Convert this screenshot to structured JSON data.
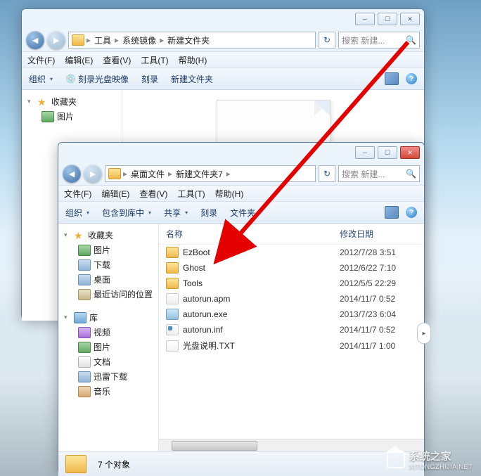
{
  "window1": {
    "breadcrumbs": [
      "工具",
      "系统镜像",
      "新建文件夹"
    ],
    "searchPlaceholder": "搜索 新建...",
    "menus": [
      "文件(F)",
      "编辑(E)",
      "查看(V)",
      "工具(T)",
      "帮助(H)"
    ],
    "toolbar": {
      "organize": "组织",
      "burn": "刻录光盘映像",
      "burn2": "刻录",
      "newfolder": "新建文件夹"
    },
    "sidebar": {
      "fav": "收藏夹",
      "pic": "图片"
    }
  },
  "window2": {
    "breadcrumbs": [
      "桌面文件",
      "新建文件夹7"
    ],
    "searchPlaceholder": "搜索 新建...",
    "menus": [
      "文件(F)",
      "编辑(E)",
      "查看(V)",
      "工具(T)",
      "帮助(H)"
    ],
    "toolbar": {
      "organize": "组织",
      "include": "包含到库中",
      "share": "共享",
      "burn": "刻录",
      "newfolder": "文件夹"
    },
    "sidebar": {
      "fav": "收藏夹",
      "pic": "图片",
      "dl": "下载",
      "desk": "桌面",
      "recent": "最近访问的位置",
      "lib": "库",
      "vid": "视频",
      "pic2": "图片",
      "doc": "文档",
      "xl": "迅雷下载",
      "mus": "音乐"
    },
    "columns": {
      "name": "名称",
      "date": "修改日期"
    },
    "files": [
      {
        "name": "EzBoot",
        "date": "2012/7/28 3:51",
        "kind": "folder"
      },
      {
        "name": "Ghost",
        "date": "2012/6/22 7:10",
        "kind": "folder"
      },
      {
        "name": "Tools",
        "date": "2012/5/5 22:29",
        "kind": "folder"
      },
      {
        "name": "autorun.apm",
        "date": "2014/11/7 0:52",
        "kind": "file"
      },
      {
        "name": "autorun.exe",
        "date": "2013/7/23 6:04",
        "kind": "exe"
      },
      {
        "name": "autorun.inf",
        "date": "2014/11/7 0:52",
        "kind": "inf"
      },
      {
        "name": "光盘说明.TXT",
        "date": "2014/11/7 1:00",
        "kind": "txt"
      }
    ],
    "status": "7 个对象"
  },
  "watermark": {
    "brand": "系统之家",
    "url": "XITONGZHIJIA.NET"
  }
}
